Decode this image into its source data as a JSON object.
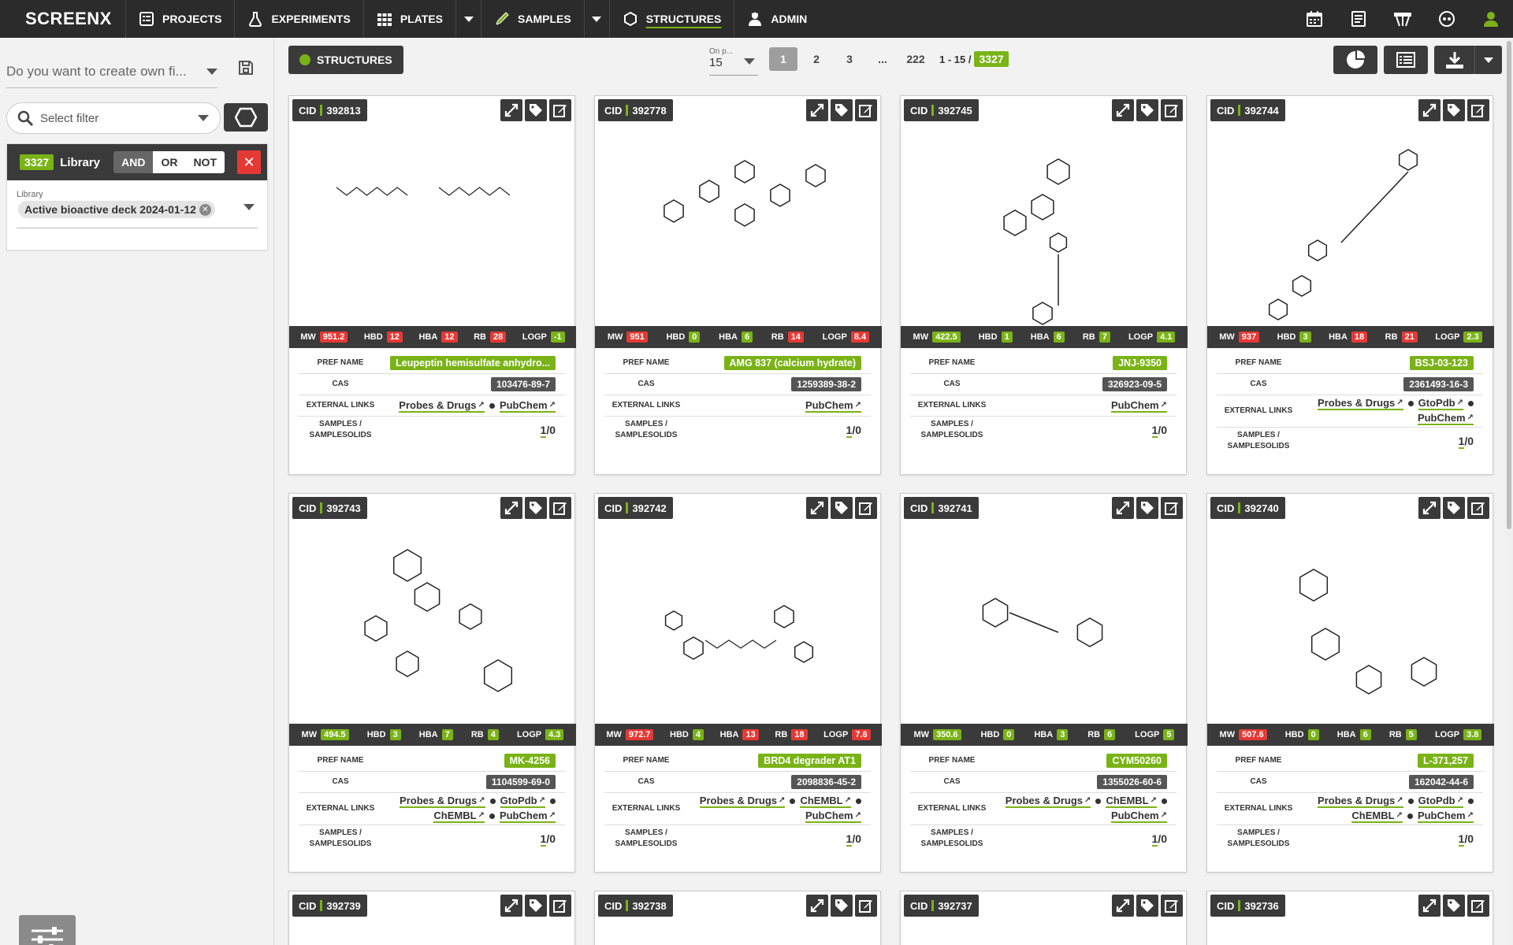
{
  "nav": {
    "logo": "SCREENX",
    "items": [
      {
        "label": "PROJECTS",
        "icon": "projects-icon"
      },
      {
        "label": "EXPERIMENTS",
        "icon": "flask-icon"
      },
      {
        "label": "PLATES",
        "icon": "plate-grid-icon"
      },
      {
        "label": "SAMPLES",
        "icon": "pipette-icon"
      },
      {
        "label": "STRUCTURES",
        "icon": "hexagon-icon"
      },
      {
        "label": "ADMIN",
        "icon": "admin-icon"
      }
    ],
    "right_icons": [
      "calendar-icon",
      "notebook-icon",
      "bench-icon",
      "support-icon",
      "user-icon"
    ]
  },
  "sidebar": {
    "query_placeholder": "Do you want to create own fi...",
    "filter_placeholder": "Select filter",
    "library": {
      "count": "3327",
      "title": "Library",
      "ops": [
        "AND",
        "OR",
        "NOT"
      ],
      "active_op": "AND",
      "field_label": "Library",
      "chip": "Active bioactive deck 2024-01-12"
    }
  },
  "main": {
    "structures_label": "STRUCTURES",
    "per_page_label": "On p...",
    "per_page_value": "15",
    "pages": [
      "1",
      "2",
      "3",
      "...",
      "222"
    ],
    "current_page": "1",
    "range": "1 - 15 /",
    "total": "3327"
  },
  "labels": {
    "mw": "MW",
    "hbd": "HBD",
    "hba": "HBA",
    "rb": "RB",
    "logp": "LOGP",
    "pref_name": "PREF NAME",
    "cas": "CAS",
    "external_links": "EXTERNAL LINKS",
    "samples_1": "SAMPLES /",
    "samples_2": "SAMPLESOLIDS",
    "cid": "CID"
  },
  "cards": [
    {
      "cid": "392813",
      "mw": "951.2",
      "mw_c": "r",
      "hbd": "12",
      "hbd_c": "r",
      "hba": "12",
      "hba_c": "r",
      "rb": "28",
      "rb_c": "r",
      "logp": "-1",
      "logp_c": "g",
      "pref_name": "Leupeptin hemisulfate anhydro...",
      "cas": "103476-89-7",
      "links": [
        "Probes & Drugs",
        "PubChem"
      ],
      "samples": "1",
      "solids": "/0"
    },
    {
      "cid": "392778",
      "mw": "951",
      "mw_c": "r",
      "hbd": "0",
      "hbd_c": "g",
      "hba": "6",
      "hba_c": "g",
      "rb": "14",
      "rb_c": "r",
      "logp": "8.4",
      "logp_c": "r",
      "pref_name": "AMG 837 (calcium hydrate)",
      "cas": "1259389-38-2",
      "links": [
        "PubChem"
      ],
      "samples": "1",
      "solids": "/0"
    },
    {
      "cid": "392745",
      "mw": "422.5",
      "mw_c": "g",
      "hbd": "1",
      "hbd_c": "g",
      "hba": "6",
      "hba_c": "g",
      "rb": "7",
      "rb_c": "g",
      "logp": "4.1",
      "logp_c": "g",
      "pref_name": "JNJ-9350",
      "cas": "326923-09-5",
      "links": [
        "PubChem"
      ],
      "samples": "1",
      "solids": "/0"
    },
    {
      "cid": "392744",
      "mw": "937",
      "mw_c": "r",
      "hbd": "3",
      "hbd_c": "g",
      "hba": "18",
      "hba_c": "r",
      "rb": "21",
      "rb_c": "r",
      "logp": "2.3",
      "logp_c": "g",
      "pref_name": "BSJ-03-123",
      "cas": "2361493-16-3",
      "links": [
        "Probes & Drugs",
        "GtoPdb",
        "PubChem"
      ],
      "samples": "1",
      "solids": "/0"
    },
    {
      "cid": "392743",
      "mw": "494.5",
      "mw_c": "g",
      "hbd": "3",
      "hbd_c": "g",
      "hba": "7",
      "hba_c": "g",
      "rb": "4",
      "rb_c": "g",
      "logp": "4.3",
      "logp_c": "g",
      "pref_name": "MK-4256",
      "cas": "1104599-69-0",
      "links": [
        "Probes & Drugs",
        "GtoPdb",
        "ChEMBL",
        "PubChem"
      ],
      "samples": "1",
      "solids": "/0"
    },
    {
      "cid": "392742",
      "mw": "972.7",
      "mw_c": "r",
      "hbd": "4",
      "hbd_c": "g",
      "hba": "13",
      "hba_c": "r",
      "rb": "18",
      "rb_c": "r",
      "logp": "7.6",
      "logp_c": "r",
      "pref_name": "BRD4 degrader AT1",
      "cas": "2098836-45-2",
      "links": [
        "Probes & Drugs",
        "ChEMBL",
        "PubChem"
      ],
      "samples": "1",
      "solids": "/0"
    },
    {
      "cid": "392741",
      "mw": "350.6",
      "mw_c": "g",
      "hbd": "0",
      "hbd_c": "g",
      "hba": "3",
      "hba_c": "g",
      "rb": "6",
      "rb_c": "g",
      "logp": "5",
      "logp_c": "g",
      "pref_name": "CYM50260",
      "cas": "1355026-60-6",
      "links": [
        "Probes & Drugs",
        "ChEMBL",
        "PubChem"
      ],
      "samples": "1",
      "solids": "/0"
    },
    {
      "cid": "392740",
      "mw": "507.6",
      "mw_c": "r",
      "hbd": "0",
      "hbd_c": "g",
      "hba": "6",
      "hba_c": "g",
      "rb": "5",
      "rb_c": "g",
      "logp": "3.8",
      "logp_c": "g",
      "pref_name": "L-371,257",
      "cas": "162042-44-6",
      "links": [
        "Probes & Drugs",
        "GtoPdb",
        "ChEMBL",
        "PubChem"
      ],
      "samples": "1",
      "solids": "/0"
    }
  ],
  "partial_cards": [
    "392739",
    "392738",
    "392737",
    "392736"
  ]
}
